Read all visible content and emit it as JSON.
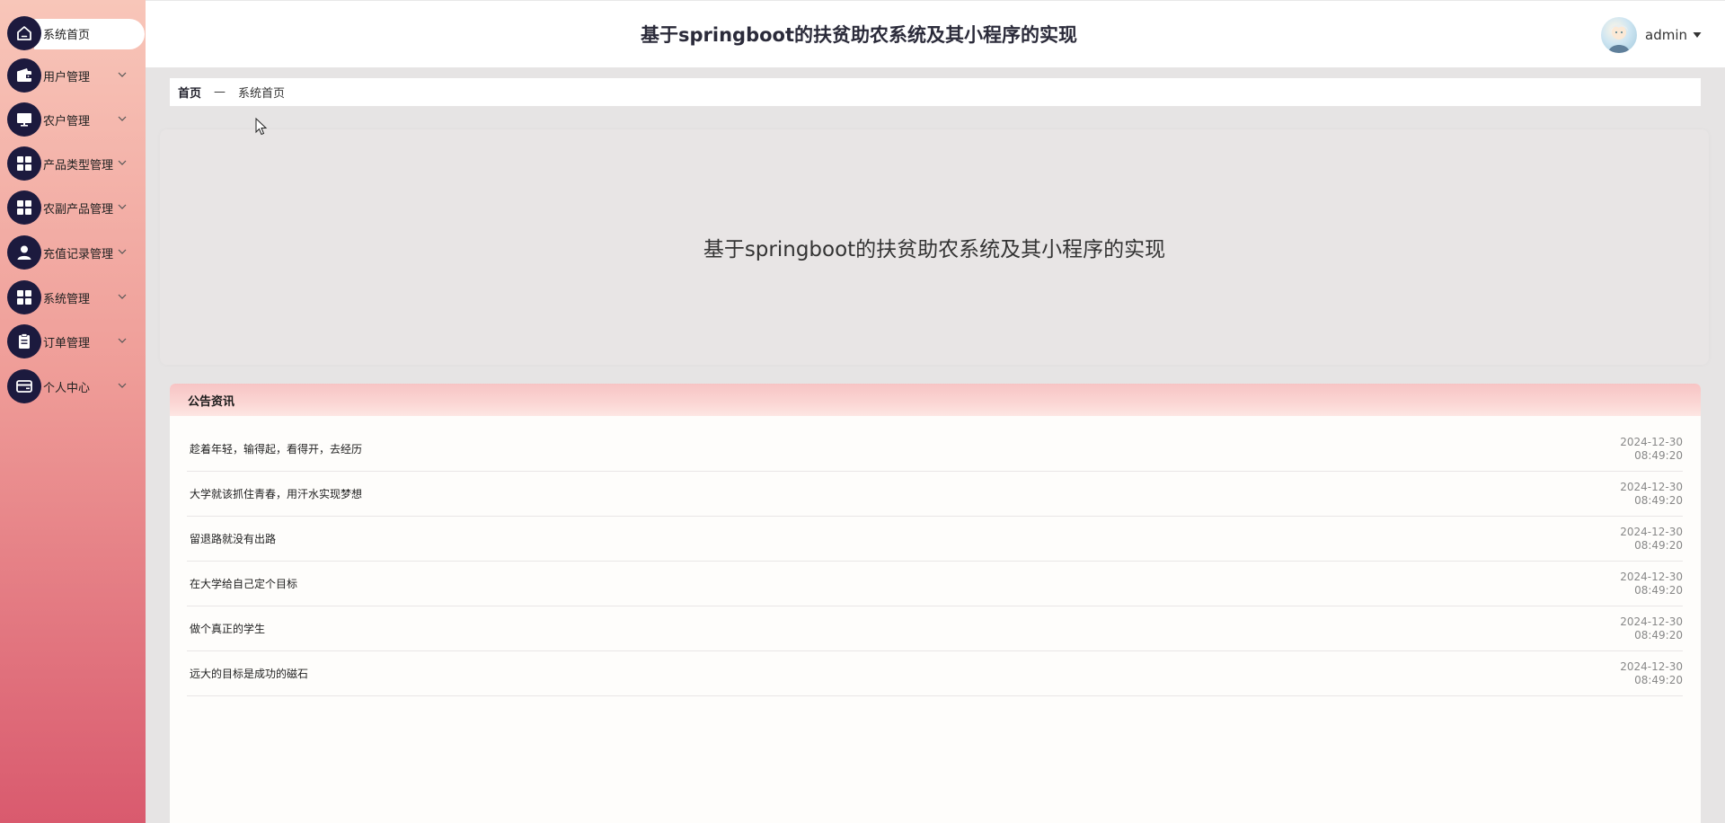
{
  "header": {
    "title": "基于springboot的扶贫助农系统及其小程序的实现",
    "user": {
      "name": "admin",
      "avatar_icon": "avatar-image",
      "caret_icon": "caret-down-icon"
    }
  },
  "sidebar": {
    "items": [
      {
        "label": "系统首页",
        "icon": "home-icon",
        "active": true
      },
      {
        "label": "用户管理",
        "icon": "wallet-icon"
      },
      {
        "label": "农户管理",
        "icon": "monitor-icon"
      },
      {
        "label": "产品类型管理",
        "icon": "grid-icon"
      },
      {
        "label": "农副产品管理",
        "icon": "grid-icon"
      },
      {
        "label": "充值记录管理",
        "icon": "user-icon"
      },
      {
        "label": "系统管理",
        "icon": "grid-icon"
      },
      {
        "label": "订单管理",
        "icon": "clipboard-icon"
      },
      {
        "label": "个人中心",
        "icon": "card-icon"
      }
    ]
  },
  "breadcrumb": {
    "home": "首页",
    "separator": "—",
    "current": "系统首页"
  },
  "banner": {
    "title": "基于springboot的扶贫助农系统及其小程序的实现"
  },
  "notice": {
    "heading": "公告资讯",
    "items": [
      {
        "text": "趁着年轻，输得起，看得开，去经历",
        "date": "2024-12-30",
        "time": "08:49:20"
      },
      {
        "text": "大学就该抓住青春，用汗水实现梦想",
        "date": "2024-12-30",
        "time": "08:49:20"
      },
      {
        "text": "留退路就没有出路",
        "date": "2024-12-30",
        "time": "08:49:20"
      },
      {
        "text": "在大学给自己定个目标",
        "date": "2024-12-30",
        "time": "08:49:20"
      },
      {
        "text": "做个真正的学生",
        "date": "2024-12-30",
        "time": "08:49:20"
      },
      {
        "text": "远大的目标是成功的磁石",
        "date": "2024-12-30",
        "time": "08:49:20"
      }
    ]
  },
  "colors": {
    "sidebar_top": "#f8c6b9",
    "sidebar_bottom": "#d95a6e",
    "icon_circle": "#1c1a3e",
    "notice_header": "#f7c4c4"
  }
}
